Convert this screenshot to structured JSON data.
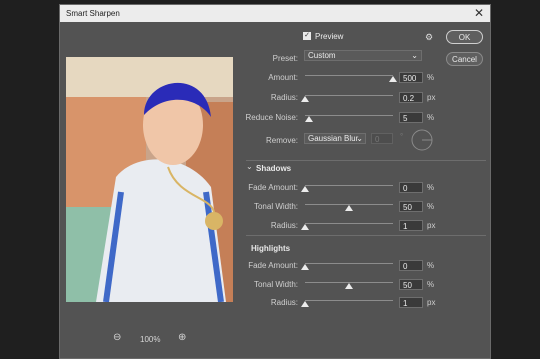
{
  "window": {
    "title": "Smart Sharpen",
    "close_glyph": "✕"
  },
  "preview": {
    "checked": true,
    "label": "Preview",
    "check_glyph": "✓"
  },
  "gear_glyph": "⚙",
  "buttons": {
    "ok": "OK",
    "cancel": "Cancel"
  },
  "preset": {
    "label": "Preset:",
    "value": "Custom"
  },
  "sharpen": [
    {
      "label": "Amount:",
      "value": "500",
      "unit": "%",
      "level": 1.0
    },
    {
      "label": "Radius:",
      "value": "0.2",
      "unit": "px",
      "level": 0.0
    },
    {
      "label": "Reduce Noise:",
      "value": "5",
      "unit": "%",
      "level": 0.05
    }
  ],
  "remove": {
    "label": "Remove:",
    "value": "Gaussian Blur",
    "angle": "0",
    "degree_sign": "°"
  },
  "shadows": {
    "title": "Shadows",
    "rows": [
      {
        "label": "Fade Amount:",
        "value": "0",
        "unit": "%",
        "level": 0.0
      },
      {
        "label": "Tonal Width:",
        "value": "50",
        "unit": "%",
        "level": 0.5
      },
      {
        "label": "Radius:",
        "value": "1",
        "unit": "px",
        "level": 0.0
      }
    ]
  },
  "highlights": {
    "title": "Highlights",
    "rows": [
      {
        "label": "Fade Amount:",
        "value": "0",
        "unit": "%",
        "level": 0.0
      },
      {
        "label": "Tonal Width:",
        "value": "50",
        "unit": "%",
        "level": 0.5
      },
      {
        "label": "Radius:",
        "value": "1",
        "unit": "px",
        "level": 0.0
      }
    ]
  },
  "zoom": {
    "level": "100%",
    "zoom_out_glyph": "⊖",
    "zoom_in_glyph": "⊕"
  },
  "colors": {
    "dialog_bg": "#535353",
    "accent_white": "#ececec"
  }
}
